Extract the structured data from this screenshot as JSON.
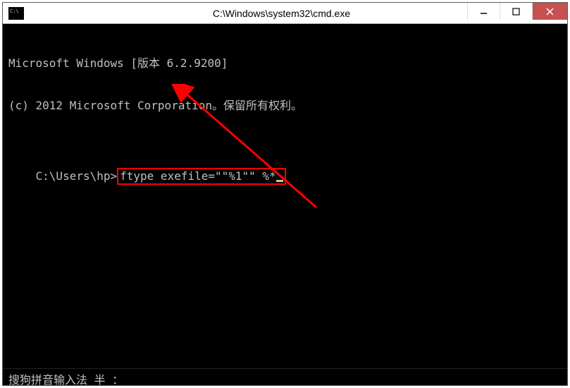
{
  "titlebar": {
    "title": "C:\\Windows\\system32\\cmd.exe"
  },
  "terminal": {
    "line1": "Microsoft Windows [版本 6.2.9200]",
    "line2": "(c) 2012 Microsoft Corporation。保留所有权利。",
    "prompt": "C:\\Users\\hp>",
    "command": "ftype exefile=\"\"%1\"\" %*"
  },
  "ime": {
    "text": "搜狗拼音输入法 半 ："
  }
}
